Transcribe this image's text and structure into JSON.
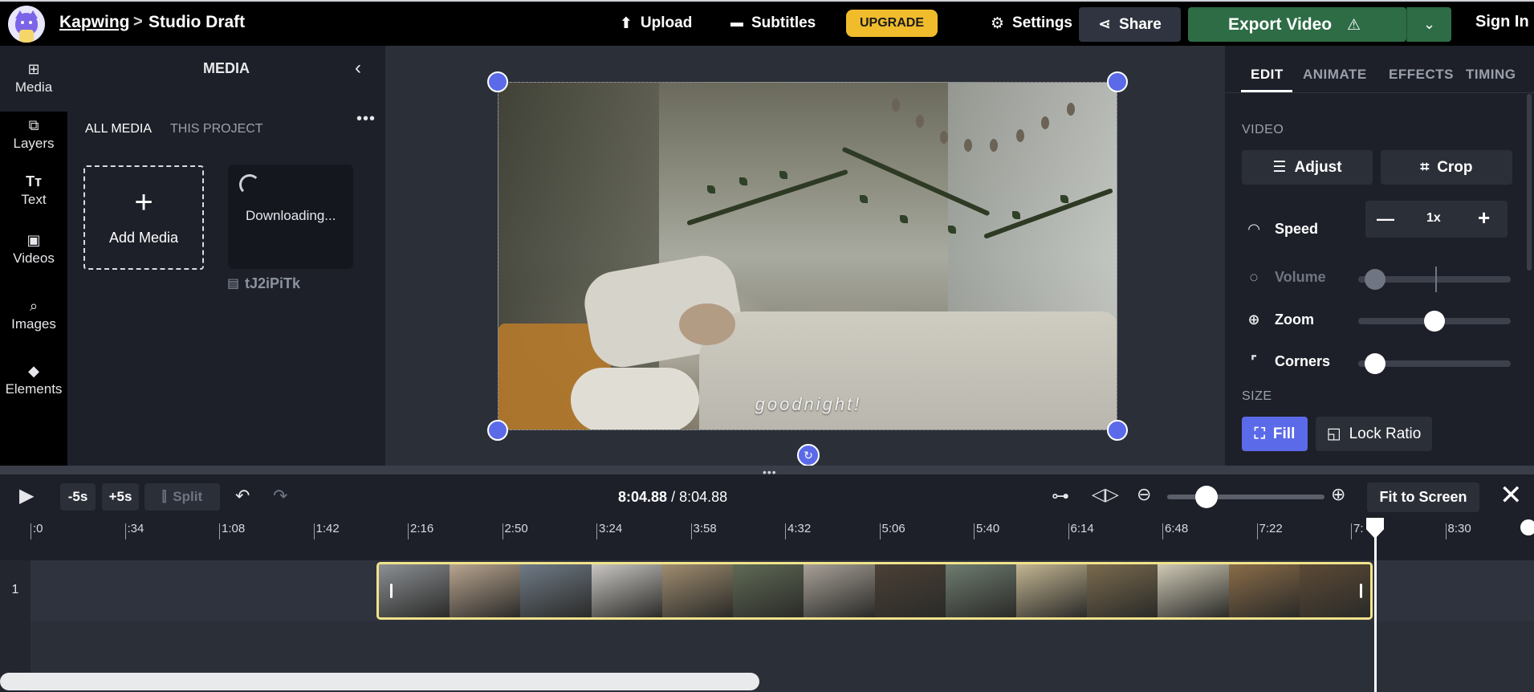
{
  "header": {
    "brand": "Kapwing",
    "separator": ">",
    "project": "Studio Draft",
    "upload": "Upload",
    "subtitles": "Subtitles",
    "upgrade": "UPGRADE",
    "settings": "Settings",
    "share": "Share",
    "export": "Export Video",
    "signin": "Sign In"
  },
  "rail": {
    "items": [
      {
        "label": "Media",
        "icon": "media-icon",
        "glyph": "⊞"
      },
      {
        "label": "Layers",
        "icon": "layers-icon",
        "glyph": "⧉"
      },
      {
        "label": "Text",
        "icon": "text-icon",
        "glyph": "Tт"
      },
      {
        "label": "Videos",
        "icon": "videos-icon",
        "glyph": "▣"
      },
      {
        "label": "Images",
        "icon": "images-icon",
        "glyph": "⌕"
      },
      {
        "label": "Elements",
        "icon": "elements-icon",
        "glyph": "◆"
      }
    ]
  },
  "media": {
    "title": "MEDIA",
    "tab_all": "ALL MEDIA",
    "tab_project": "THIS PROJECT",
    "add_media": "Add Media",
    "downloading": "Downloading...",
    "filename": "tJ2iPiTk"
  },
  "canvas": {
    "caption": "goodnight!"
  },
  "right": {
    "tabs": [
      "EDIT",
      "ANIMATE",
      "EFFECTS",
      "TIMING"
    ],
    "section_video": "VIDEO",
    "adjust": "Adjust",
    "crop": "Crop",
    "speed_label": "Speed",
    "speed_value": "1x",
    "volume_label": "Volume",
    "zoom_label": "Zoom",
    "corners_label": "Corners",
    "section_size": "SIZE",
    "fill": "Fill",
    "lock_ratio": "Lock Ratio",
    "sliders": {
      "volume": 0.05,
      "zoom": 0.5,
      "corners": 0.05
    }
  },
  "timeline": {
    "minus5": "-5s",
    "plus5": "+5s",
    "split": "Split",
    "current_time": "8:04.88",
    "total_time": "8:04.88",
    "fit": "Fit to Screen",
    "row_number": "1",
    "ruler": [
      ":0",
      ":34",
      "1:08",
      "1:42",
      "2:16",
      "2:50",
      "3:24",
      "3:58",
      "4:32",
      "5:06",
      "5:40",
      "6:14",
      "6:48",
      "7:22",
      "7:",
      "8:30"
    ]
  },
  "colors": {
    "accent": "#5b6ae8",
    "export_green": "#2e6c46",
    "upgrade_yellow": "#f0bc2c",
    "clip_border": "#f0e38a"
  }
}
